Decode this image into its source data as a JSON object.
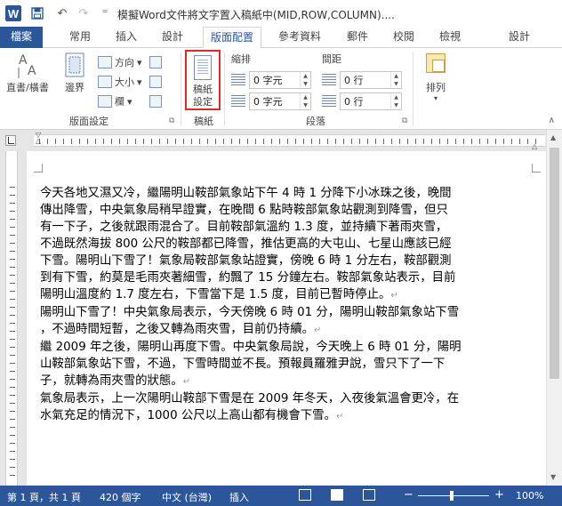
{
  "titlebar": {
    "app_icon": "W",
    "title": "模擬Word文件將文字置入稿紙中(MID,ROW,COLUMN)...."
  },
  "ribbon_tabs": [
    "檔案",
    "常用",
    "插入",
    "設計",
    "版面配置",
    "參考資料",
    "郵件",
    "校閱",
    "檢視",
    "設計"
  ],
  "ribbon": {
    "text_direction": "直書/橫書",
    "margins": "邊界",
    "orientation": "方向",
    "size": "大小",
    "columns": "欄",
    "page_setup_group": "版面設定",
    "manuscript_line1": "稿紙",
    "manuscript_line2": "設定",
    "manuscript_group": "稿紙",
    "indent_head": "縮排",
    "spacing_head": "間距",
    "indent_left": "0 字元",
    "indent_right": "0 字元",
    "spacing_before": "0 行",
    "spacing_after": "0 行",
    "paragraph_group": "段落",
    "arrange": "排列"
  },
  "document": {
    "paragraphs": [
      [
        "今天各地又濕又冷，繼陽明山鞍部氣象站下午 4 時 1 分降下小冰珠之後，晚間",
        "傳出降雪，中央氣象局稍早證實，在晚間 6 點時鞍部氣象站觀測到降雪，但只",
        "有一下子，之後就跟雨混合了。目前鞍部氣溫約 1.3 度，並持續下著雨夾雪，",
        "不過既然海拔 800 公尺的鞍部都已降雪，推估更高的大屯山、七星山應該已經",
        "下雪。陽明山下雪了！氣象局鞍部氣象站證實，傍晚 6 時 1 分左右，鞍部觀測",
        "到有下雪，約莫是毛雨夾著細雪，約飄了 15 分鐘左右。鞍部氣象站表示，目前",
        "陽明山溫度約 1.7 度左右，下雪當下是 1.5 度，目前已暫時停止。"
      ],
      [
        "陽明山下雪了！中央氣象局表示，今天傍晚 6 時 01 分，陽明山鞍部氣象站下雪",
        "，不過時間短暫，之後又轉為雨夾雪，目前仍持續。"
      ],
      [
        "繼 2009 年之後，陽明山再度下雪。中央氣象局說，今天晚上 6 時 01 分，陽明",
        "山鞍部氣象站下雪，不過，下雪時間並不長。預報員羅雅尹說，雪只下了一下",
        "子，就轉為雨夾雪的狀態。"
      ],
      [
        "氣象局表示，上一次陽明山鞍部下雪是在 2009 年冬天，入夜後氣溫會更冷，在",
        "水氣充足的情況下，1000 公尺以上高山都有機會下雪。"
      ]
    ],
    "para_mark": "↵"
  },
  "statusbar": {
    "page": "第 1 頁，共 1 頁",
    "words": "420 個字",
    "language": "中文 (台灣)",
    "mode": "插入",
    "zoom": "100%",
    "zoom_minus": "−",
    "zoom_plus": "+"
  },
  "colors": {
    "accent": "#2b579a",
    "highlight_border": "#e0272a"
  }
}
